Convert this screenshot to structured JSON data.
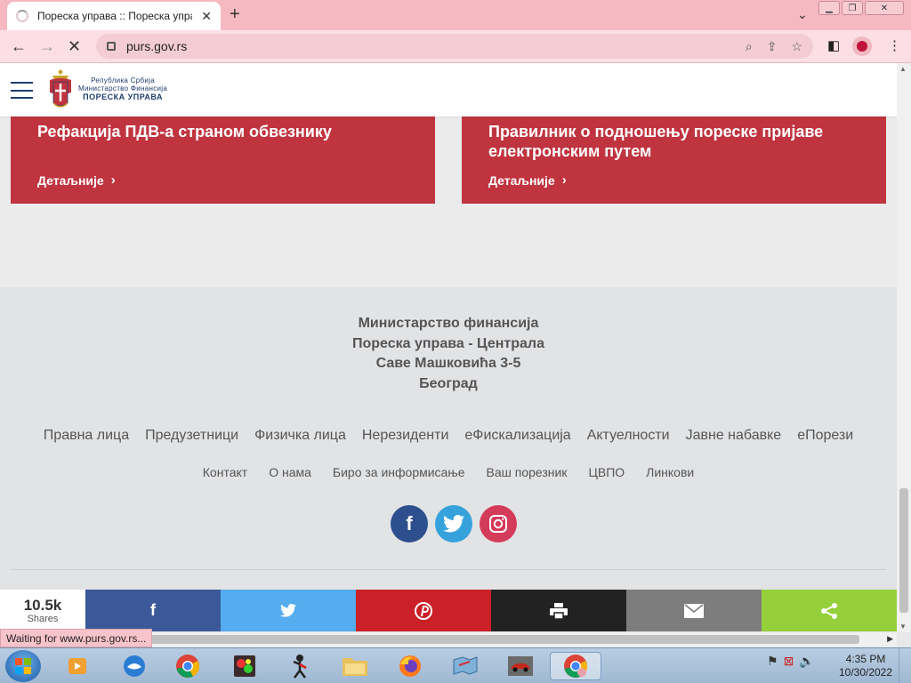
{
  "browser": {
    "tab_title": "Пореска управа :: Пореска упра",
    "tab_close": "✕",
    "new_tab": "+",
    "url": "purs.gov.rs",
    "status_text": "Waiting for www.purs.gov.rs..."
  },
  "header": {
    "logo_line1": "Република Србија",
    "logo_line2": "Министарство Финансија",
    "logo_line3": "ПОРЕСКА УПРАВА"
  },
  "cards": [
    {
      "title": "Рефакција ПДВ-а страном обвезнику",
      "more": "Детаљније"
    },
    {
      "title": "Правилник о подношењу пореске пријаве електронским путем",
      "more": "Детаљније"
    }
  ],
  "footer": {
    "address_lines": [
      "Министарство финансија",
      "Пореска управа - Централа",
      "Саве Машковића 3-5",
      "Београд"
    ],
    "primary_links": [
      "Правна лица",
      "Предузетници",
      "Физичка лица",
      "Нерезиденти",
      "еФискализација",
      "Актуелности",
      "Јавне набавке",
      "еПорези"
    ],
    "secondary_links": [
      "Контакт",
      "О нама",
      "Биро за информисање",
      "Ваш порезник",
      "ЦВПО",
      "Линкови"
    ],
    "social": [
      "facebook-icon",
      "twitter-icon",
      "instagram-icon"
    ]
  },
  "sharebar": {
    "count": "10.5k",
    "count_label": "Shares",
    "buttons": [
      {
        "name": "facebook",
        "glyph": "f",
        "color": "#3b5998"
      },
      {
        "name": "twitter",
        "glyph": "🐦",
        "color": "#55acee"
      },
      {
        "name": "pinterest",
        "glyph": "P",
        "color": "#cb2027"
      },
      {
        "name": "print",
        "glyph": "🖶",
        "color": "#222222"
      },
      {
        "name": "email",
        "glyph": "✉",
        "color": "#7d7d7d"
      },
      {
        "name": "share",
        "glyph": "⋖",
        "color": "#95d03a"
      }
    ]
  },
  "taskbar": {
    "time": "4:35 PM",
    "date": "10/30/2022"
  },
  "colors": {
    "card_red": "#c0343f",
    "brand_blue": "#1f3d6b",
    "tab_pink": "#f6b9c2"
  }
}
